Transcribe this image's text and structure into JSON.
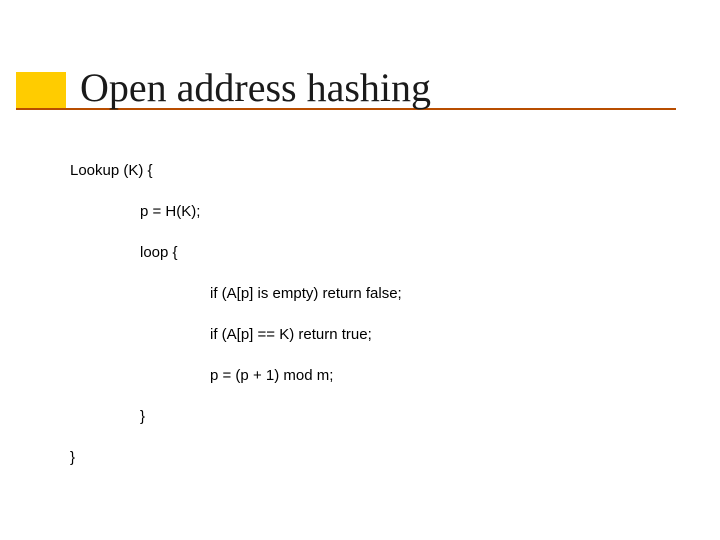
{
  "title": "Open address hashing",
  "code": {
    "l1": "Lookup (K) {",
    "l2": "p = H(K);",
    "l3": "loop {",
    "l4": "if (A[p] is empty) return false;",
    "l5": "if (A[p] == K) return true;",
    "l6": "p = (p + 1) mod m;",
    "l7": "}",
    "l8": "}"
  }
}
